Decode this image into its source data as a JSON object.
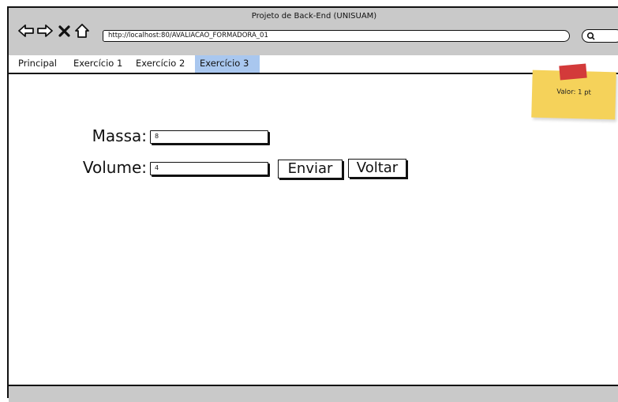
{
  "window": {
    "title": "Projeto de Back-End (UNISUAM)",
    "url": "http://localhost:80/AVALIACAO_FORMADORA_01"
  },
  "tabs": [
    {
      "label": "Principal",
      "active": false
    },
    {
      "label": "Exercício 1",
      "active": false
    },
    {
      "label": "Exercício 2",
      "active": false
    },
    {
      "label": "Exercício 3",
      "active": true
    }
  ],
  "sticky_note": {
    "text": "Valor: 1 pt"
  },
  "form": {
    "massa_label": "Massa:",
    "massa_value": "8",
    "volume_label": "Volume:",
    "volume_value": "4",
    "submit_label": "Enviar",
    "back_label": "Voltar"
  },
  "colors": {
    "titlebar": "#c9c9c9",
    "active_tab": "#a9c7ef",
    "sticky": "#f5d25a",
    "tape": "#d33a3a"
  },
  "icons": [
    "back-arrow-icon",
    "forward-arrow-icon",
    "close-icon",
    "home-icon",
    "search-icon"
  ]
}
